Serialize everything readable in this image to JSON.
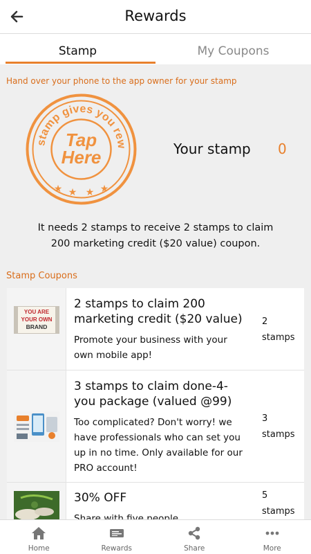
{
  "header": {
    "title": "Rewards",
    "back_icon": "arrow-left-icon"
  },
  "tabs": [
    {
      "label": "Stamp",
      "active": true
    },
    {
      "label": "My Coupons",
      "active": false
    }
  ],
  "stamp_section": {
    "hint": "Hand over your phone to the app owner for your stamp",
    "stamp_ring_text": "This stamp gives you rewards",
    "stamp_center_line1": "Tap",
    "stamp_center_line2": "Here",
    "your_stamp_label": "Your stamp",
    "your_stamp_count": "0",
    "needs_line1": "It needs 2 stamps to receive 2 stamps to claim",
    "needs_line2": "200 marketing credit ($20 value) coupon."
  },
  "coupons_section": {
    "title": "Stamp Coupons",
    "items": [
      {
        "title_line1": "2 stamps to claim 200",
        "title_line2": "marketing credit ($20 value)",
        "desc_line1": "Promote your business with your",
        "desc_line2": "own mobile app!",
        "stamps_count": "2",
        "stamps_unit": "stamps",
        "thumb_line1": "YOU ARE",
        "thumb_line2": "YOUR OWN",
        "thumb_line3": "BRAND"
      },
      {
        "title_line1": "3 stamps to claim done-4-",
        "title_line2": "you package (valued @99)",
        "desc_line1": "Too complicated? Don't worry! we",
        "desc_line2": "have professionals who can set you",
        "desc_line3": "up in no time. Only available for our",
        "desc_line4": "PRO account!",
        "stamps_count": "3",
        "stamps_unit": "stamps"
      },
      {
        "title_line1": "30% OFF",
        "desc_line1": "Share with five people",
        "stamps_count": "5",
        "stamps_unit": "stamps"
      }
    ]
  },
  "bottom_nav": [
    {
      "label": "Home",
      "icon": "home-icon"
    },
    {
      "label": "Rewards",
      "icon": "ticket-icon"
    },
    {
      "label": "Share",
      "icon": "share-icon"
    },
    {
      "label": "More",
      "icon": "more-dots-icon"
    }
  ],
  "colors": {
    "accent": "#e8802c",
    "accent_text": "#d96d1a"
  }
}
